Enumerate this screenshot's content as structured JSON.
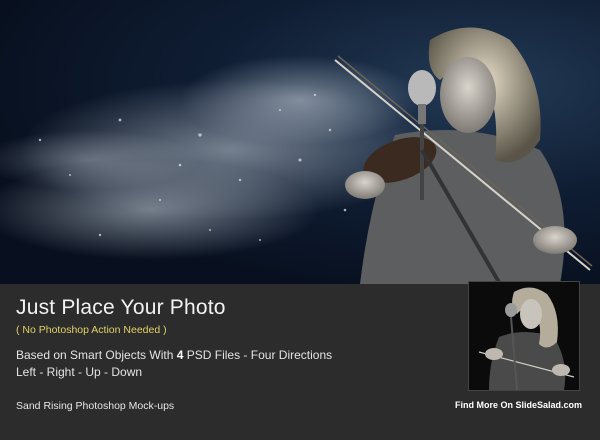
{
  "heading": {
    "title": "Just Place Your Photo",
    "subtitle": "( No Photoshop Action Needed )"
  },
  "details": {
    "line1_prefix": "Based on Smart Objects With ",
    "line1_count": "4",
    "line1_suffix": " PSD Files - Four Directions",
    "line2": "Left - Right - Up - Down"
  },
  "footer": {
    "product_name": "Sand Rising Photoshop Mock-ups",
    "site_link": "Find More On SlideSalad.com"
  },
  "colors": {
    "panel_background": "#2c2c2c",
    "subtitle_accent": "#e0d267",
    "hero_background": "#0f1d33"
  }
}
